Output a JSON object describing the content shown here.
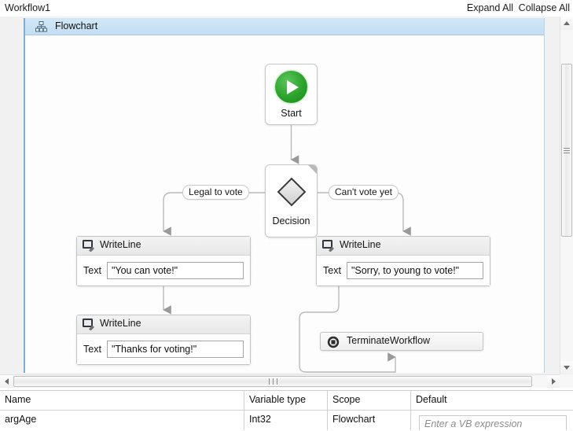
{
  "window": {
    "title": "Workflow1",
    "expand_all": "Expand All",
    "collapse_all": "Collapse All"
  },
  "designer": {
    "root_label": "Flowchart",
    "root_icon": "flowchart-icon",
    "nodes": {
      "start": {
        "label": "Start",
        "icon": "play-icon"
      },
      "decision": {
        "label": "Decision",
        "icon": "diamond-icon"
      },
      "branch_true": "Legal to vote",
      "branch_false": "Can't vote yet",
      "writeline_left": {
        "title": "WriteLine",
        "icon": "writeline-icon",
        "field_label": "Text",
        "value": "\"You can vote!\""
      },
      "writeline_right": {
        "title": "WriteLine",
        "icon": "writeline-icon",
        "field_label": "Text",
        "value": "\"Sorry, to young to vote!\""
      },
      "writeline_thanks": {
        "title": "WriteLine",
        "icon": "writeline-icon",
        "field_label": "Text",
        "value": "\"Thanks for voting!\""
      },
      "terminate": {
        "title": "TerminateWorkflow",
        "icon": "terminate-icon"
      }
    }
  },
  "variables": {
    "columns": [
      "Name",
      "Variable type",
      "Scope",
      "Default"
    ],
    "rows": [
      {
        "name": "argAge",
        "type": "Int32",
        "scope": "Flowchart",
        "default_placeholder": "Enter a VB expression"
      }
    ]
  }
}
